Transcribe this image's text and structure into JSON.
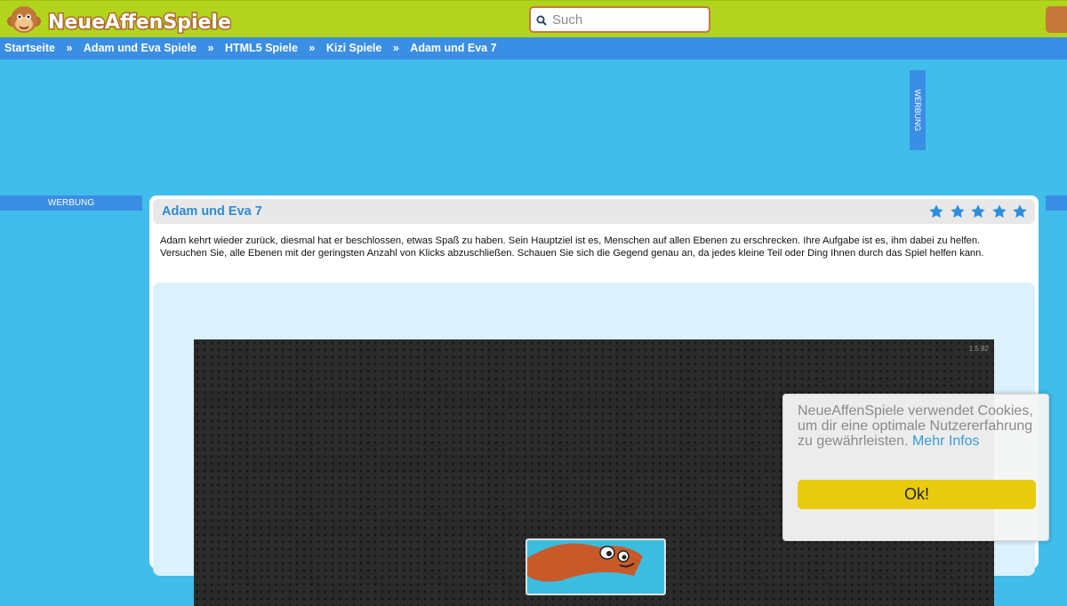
{
  "header": {
    "logo_text": "NeueAffenSpiele.de",
    "search": {
      "placeholder": "Such",
      "value": ""
    }
  },
  "breadcrumb": {
    "separator": "»",
    "items": [
      "Startseite",
      "Adam und Eva Spiele",
      "HTML5 Spiele",
      "Kizi Spiele",
      "Adam und Eva 7"
    ]
  },
  "ads": {
    "top_label": "WERBUNG",
    "left_label": "WERBUNG"
  },
  "game": {
    "title": "Adam und Eva 7",
    "rating": 5,
    "rating_max": 5,
    "description": "Adam kehrt wieder zurück, diesmal hat er beschlossen, etwas Spaß zu haben. Sein Hauptziel ist es, Menschen auf allen Ebenen zu erschrecken. Ihre Aufgabe ist es, ihm dabei zu helfen. Versuchen Sie, alle Ebenen mit der geringsten Anzahl von Klicks abzuschließen. Schauen Sie sich die Gegend genau an, da jedes kleine Teil oder Ding Ihnen durch das Spiel helfen kann.",
    "version": "1.5.82"
  },
  "cookie_banner": {
    "text": "NeueAffenSpiele verwendet Cookies, um dir eine optimale Nutzererfahrung zu gewährleisten.",
    "link_text": "Mehr Infos",
    "button_label": "Ok!"
  },
  "colors": {
    "page_bg": "#40bdea",
    "header_bg": "#b3d41c",
    "nav_bg": "#3a8ee3",
    "title_color": "#2e8bd3",
    "star_color": "#2e8ee0",
    "cookie_button": "#e8cb0c"
  },
  "icons": {
    "search": "search-icon",
    "star": "star-icon",
    "logo": "monkey-logo"
  }
}
